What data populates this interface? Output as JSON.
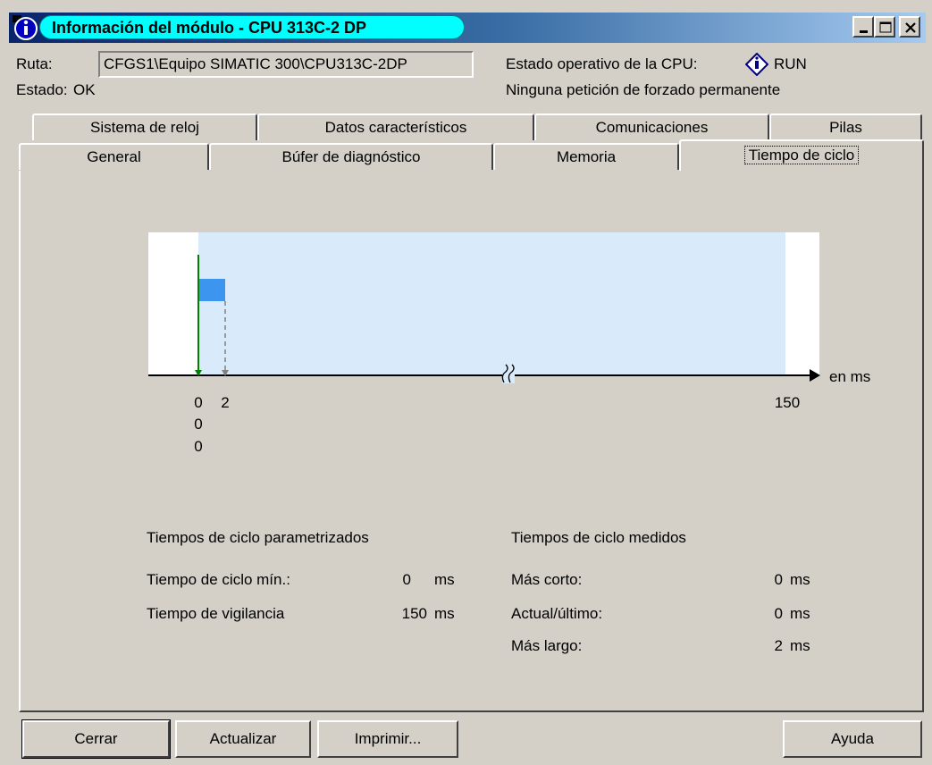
{
  "window": {
    "title": "Información del módulo - CPU 313C-2 DP",
    "icon": "info-icon",
    "controls": [
      "minimize-icon",
      "maximize-icon",
      "close-icon"
    ]
  },
  "info": {
    "path_label": "Ruta:",
    "path_value": "CFGS1\\Equipo SIMATIC 300\\CPU313C-2DP",
    "state_label": "Estado:",
    "state_value": "OK",
    "cpu_mode_label": "Estado operativo de la CPU:",
    "cpu_mode_value": "RUN",
    "forcing_text": "Ninguna petición de forzado permanente"
  },
  "tabs_row1": [
    "Sistema de reloj",
    "Datos característicos",
    "Comunicaciones",
    "Pilas"
  ],
  "tabs_row2": [
    "General",
    "Búfer de diagnóstico",
    "Memoria",
    "Tiempo de ciclo"
  ],
  "active_tab": "Tiempo de ciclo",
  "chart_data": {
    "type": "bar",
    "x_unit": "en ms",
    "x_ticks": [
      "0",
      "2",
      "150"
    ],
    "min_cycle_ms": 0,
    "watchdog_ms": 150,
    "shortest_ms": 0,
    "current_ms": 0,
    "longest_ms": 2,
    "bar": {
      "from": 0,
      "to": 2
    },
    "under_zero_labels": [
      "0",
      "0"
    ],
    "colors": {
      "range_fill": "#d9ebfa",
      "bar_fill": "#3c96f0",
      "current_marker": "#008000",
      "longest_marker": "#808080"
    }
  },
  "param_section": {
    "heading": "Tiempos de ciclo parametrizados",
    "rows": [
      {
        "label": "Tiempo de ciclo mín.:",
        "value": "0",
        "unit": "ms"
      },
      {
        "label": "Tiempo de vigilancia",
        "value": "150",
        "unit": "ms"
      }
    ]
  },
  "measured_section": {
    "heading": "Tiempos de ciclo medidos",
    "rows": [
      {
        "label": "Más corto:",
        "value": "0",
        "unit": "ms"
      },
      {
        "label": "Actual/último:",
        "value": "0",
        "unit": "ms"
      },
      {
        "label": "Más largo:",
        "value": "2",
        "unit": "ms"
      }
    ]
  },
  "buttons": {
    "close": "Cerrar",
    "update": "Actualizar",
    "print": "Imprimir...",
    "help": "Ayuda"
  }
}
